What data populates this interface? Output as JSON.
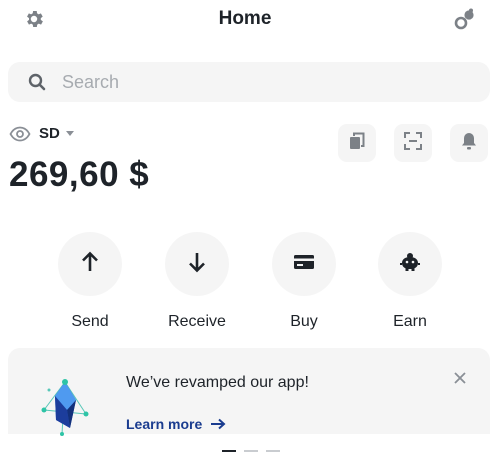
{
  "header": {
    "title": "Home"
  },
  "search": {
    "placeholder": "Search"
  },
  "balance": {
    "currency": "SD",
    "amount": "269,60 $"
  },
  "actions": [
    {
      "label": "Send"
    },
    {
      "label": "Receive"
    },
    {
      "label": "Buy"
    },
    {
      "label": "Earn"
    }
  ],
  "banner": {
    "title": "We’ve revamped our app!",
    "link": "Learn more"
  },
  "carousel": {
    "total": 3,
    "active_index": 0
  },
  "colors": {
    "text": "#1e2329",
    "surface": "#f5f5f5",
    "link": "#1a3c8f",
    "muted": "#a7abb0"
  }
}
